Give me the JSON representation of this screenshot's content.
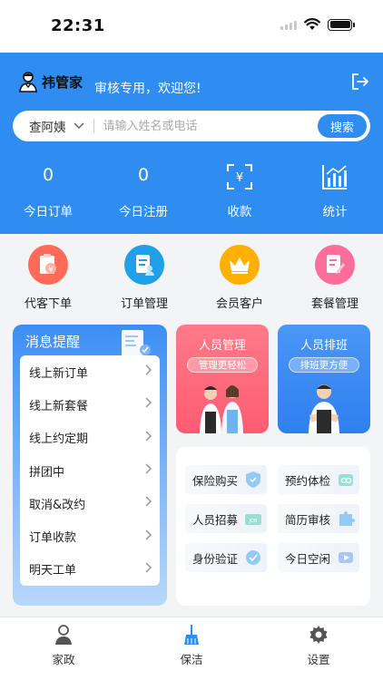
{
  "status_bar": {
    "time": "22:31"
  },
  "header": {
    "brand_name": "祎管家",
    "welcome": "审核专用，欢迎您!"
  },
  "search": {
    "selected_filter": "查阿姨",
    "placeholder": "请输入姓名或电话",
    "button_label": "搜索"
  },
  "stats": [
    {
      "value": "0",
      "label": "今日订单"
    },
    {
      "value": "0",
      "label": "今日注册"
    },
    {
      "label": "收款",
      "icon": "scan-pay-icon"
    },
    {
      "label": "统计",
      "icon": "bar-chart-icon"
    }
  ],
  "quick_actions": [
    {
      "label": "代客下单",
      "icon": "order-yen-icon",
      "color": "#ff6b57"
    },
    {
      "label": "订单管理",
      "icon": "doc-user-icon",
      "color": "#1fa0e8"
    },
    {
      "label": "会员客户",
      "icon": "crown-icon",
      "color": "#ffb000"
    },
    {
      "label": "套餐管理",
      "icon": "edit-doc-icon",
      "color": "#ff6d9a"
    }
  ],
  "messages": {
    "title": "消息提醒",
    "items": [
      {
        "label": "线上新订单"
      },
      {
        "label": "线上新套餐"
      },
      {
        "label": "线上约定期"
      },
      {
        "label": "拼团中"
      },
      {
        "label": "取消&改约"
      },
      {
        "label": "订单收款"
      },
      {
        "label": "明天工单"
      }
    ]
  },
  "cards": {
    "staff_mgmt": {
      "title": "人员管理",
      "tag": "管理更轻松",
      "color": "#ff6478"
    },
    "staff_schedule": {
      "title": "人员排班",
      "tag": "排班更方便",
      "color": "#3b8cf4"
    }
  },
  "services": [
    {
      "label": "保险购买"
    },
    {
      "label": "预约体检"
    },
    {
      "label": "人员招募"
    },
    {
      "label": "简历审核"
    },
    {
      "label": "身份验证"
    },
    {
      "label": "今日空闲"
    }
  ],
  "tabbar": [
    {
      "label": "家政",
      "icon": "nanny-icon"
    },
    {
      "label": "保洁",
      "icon": "broom-icon",
      "active": true
    },
    {
      "label": "设置",
      "icon": "gear-icon"
    }
  ],
  "colors": {
    "primary": "#2f8cf0",
    "active_tab": "#2f8cf0"
  }
}
